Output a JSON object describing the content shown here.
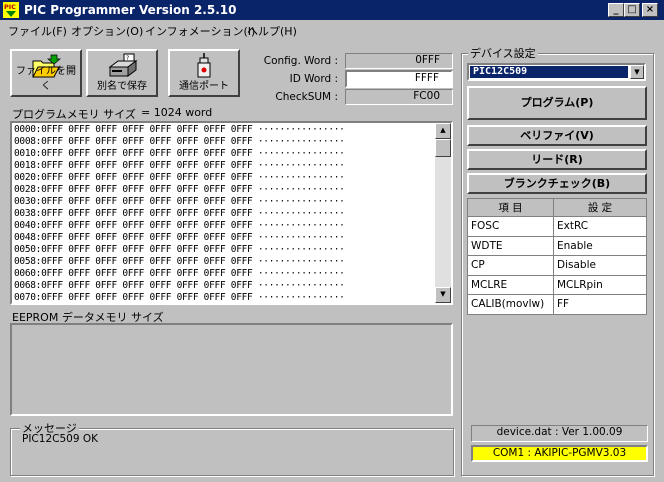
{
  "window": {
    "app_icon": "pic-chip-icon",
    "title": "PIC Programmer Version 2.5.10",
    "minimize": "_",
    "maximize": "□",
    "close": "×"
  },
  "menu": [
    "ファイル(F)",
    "オプション(O)",
    "インフォメーション(I)",
    "ヘルプ(H)"
  ],
  "toolbar": {
    "open": {
      "label": "ファイルを開く",
      "icon": "folder-open-icon"
    },
    "saveas": {
      "label": "別名で保存",
      "icon": "save-drive-icon"
    },
    "port": {
      "label": "通信ポート",
      "icon": "connector-icon"
    }
  },
  "config": {
    "config_word_label": "Config. Word :",
    "config_word_value": "0FFF",
    "id_word_label": "ID Word :",
    "id_word_value": "FFFF",
    "checksum_label": "CheckSUM :",
    "checksum_value": "FC00"
  },
  "program_memory": {
    "label": "プログラムメモリ サイズ",
    "size": "= 1024 word",
    "rows": [
      "0000:0FFF 0FFF 0FFF 0FFF 0FFF 0FFF 0FFF 0FFF ················",
      "0008:0FFF 0FFF 0FFF 0FFF 0FFF 0FFF 0FFF 0FFF ················",
      "0010:0FFF 0FFF 0FFF 0FFF 0FFF 0FFF 0FFF 0FFF ················",
      "0018:0FFF 0FFF 0FFF 0FFF 0FFF 0FFF 0FFF 0FFF ················",
      "0020:0FFF 0FFF 0FFF 0FFF 0FFF 0FFF 0FFF 0FFF ················",
      "0028:0FFF 0FFF 0FFF 0FFF 0FFF 0FFF 0FFF 0FFF ················",
      "0030:0FFF 0FFF 0FFF 0FFF 0FFF 0FFF 0FFF 0FFF ················",
      "0038:0FFF 0FFF 0FFF 0FFF 0FFF 0FFF 0FFF 0FFF ················",
      "0040:0FFF 0FFF 0FFF 0FFF 0FFF 0FFF 0FFF 0FFF ················",
      "0048:0FFF 0FFF 0FFF 0FFF 0FFF 0FFF 0FFF 0FFF ················",
      "0050:0FFF 0FFF 0FFF 0FFF 0FFF 0FFF 0FFF 0FFF ················",
      "0058:0FFF 0FFF 0FFF 0FFF 0FFF 0FFF 0FFF 0FFF ················",
      "0060:0FFF 0FFF 0FFF 0FFF 0FFF 0FFF 0FFF 0FFF ················",
      "0068:0FFF 0FFF 0FFF 0FFF 0FFF 0FFF 0FFF 0FFF ················",
      "0070:0FFF 0FFF 0FFF 0FFF 0FFF 0FFF 0FFF 0FFF ················"
    ]
  },
  "eeprom": {
    "label": "EEPROM データメモリ サイズ"
  },
  "message": {
    "legend": "メッセージ",
    "text": "PIC12C509 OK"
  },
  "device": {
    "legend": "デバイス設定",
    "selected": "PIC12C509",
    "buttons": {
      "program": "プログラム(P)",
      "verify": "ベリファイ(V)",
      "read": "リード(R)",
      "blank": "ブランクチェック(B)"
    },
    "table": {
      "header_item": "項 目",
      "header_setting": "設 定",
      "rows": [
        {
          "item": "FOSC",
          "setting": "ExtRC"
        },
        {
          "item": "WDTE",
          "setting": "Enable"
        },
        {
          "item": "CP",
          "setting": "Disable"
        },
        {
          "item": "MCLRE",
          "setting": "MCLRpin"
        },
        {
          "item": "CALIB(movlw)",
          "setting": "FF"
        }
      ]
    },
    "version": "device.dat : Ver 1.00.09",
    "com": "COM1 : AKIPIC-PGMV3.03"
  },
  "colors": {
    "titlebar": "#0a246a",
    "face": "#c0c0c0",
    "com_highlight": "#ffff00"
  }
}
